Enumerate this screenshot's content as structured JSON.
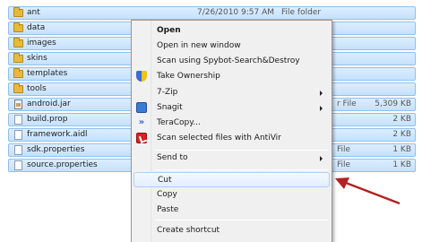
{
  "files": [
    {
      "name": "ant",
      "date": "7/26/2010 9:57 AM",
      "type": "File folder",
      "size": "",
      "icon": "folder-icon"
    },
    {
      "name": "data",
      "date": "",
      "type": "",
      "size": "",
      "icon": "folder-icon"
    },
    {
      "name": "images",
      "date": "",
      "type": "",
      "size": "",
      "icon": "folder-icon"
    },
    {
      "name": "skins",
      "date": "",
      "type": "",
      "size": "",
      "icon": "folder-icon"
    },
    {
      "name": "templates",
      "date": "",
      "type": "",
      "size": "",
      "icon": "folder-icon"
    },
    {
      "name": "tools",
      "date": "",
      "type": "",
      "size": "",
      "icon": "folder-icon"
    },
    {
      "name": "android.jar",
      "date": "",
      "type": "r File",
      "size": "5,309 KB",
      "icon": "jar-icon"
    },
    {
      "name": "build.prop",
      "date": "",
      "type": "",
      "size": "2 KB",
      "icon": "doc-icon"
    },
    {
      "name": "framework.aidl",
      "date": "",
      "type": "",
      "size": "2 KB",
      "icon": "doc-icon"
    },
    {
      "name": "sdk.properties",
      "date": "",
      "type": "File",
      "size": "1 KB",
      "icon": "doc-icon"
    },
    {
      "name": "source.properties",
      "date": "",
      "type": "File",
      "size": "1 KB",
      "icon": "doc-icon"
    }
  ],
  "context_menu": {
    "items": [
      {
        "label": "Open",
        "bold": true,
        "icon": "",
        "submenu": false
      },
      {
        "label": "Open in new window",
        "bold": false,
        "icon": "",
        "submenu": false
      },
      {
        "label": "Scan using Spybot-Search&Destroy",
        "bold": false,
        "icon": "",
        "submenu": false
      },
      {
        "label": "Take Ownership",
        "bold": false,
        "icon": "shield-icon",
        "submenu": false
      },
      {
        "label": "7-Zip",
        "bold": false,
        "icon": "",
        "submenu": true
      },
      {
        "label": "Snagit",
        "bold": false,
        "icon": "snagit-icon",
        "submenu": true
      },
      {
        "label": "TeraCopy...",
        "bold": false,
        "icon": "teracopy-icon",
        "submenu": false
      },
      {
        "label": "Scan selected files with AntiVir",
        "bold": false,
        "icon": "antivir-icon",
        "submenu": false
      },
      {
        "label": "Send to",
        "bold": false,
        "icon": "",
        "submenu": true
      },
      {
        "label": "Cut",
        "bold": false,
        "icon": "",
        "submenu": false,
        "highlighted": true
      },
      {
        "label": "Copy",
        "bold": false,
        "icon": "",
        "submenu": false
      },
      {
        "label": "Paste",
        "bold": false,
        "icon": "",
        "submenu": false
      },
      {
        "label": "Create shortcut",
        "bold": false,
        "icon": "",
        "submenu": false
      }
    ]
  },
  "colors": {
    "selection": "#c6e1fb",
    "arrow": "#b22222"
  }
}
